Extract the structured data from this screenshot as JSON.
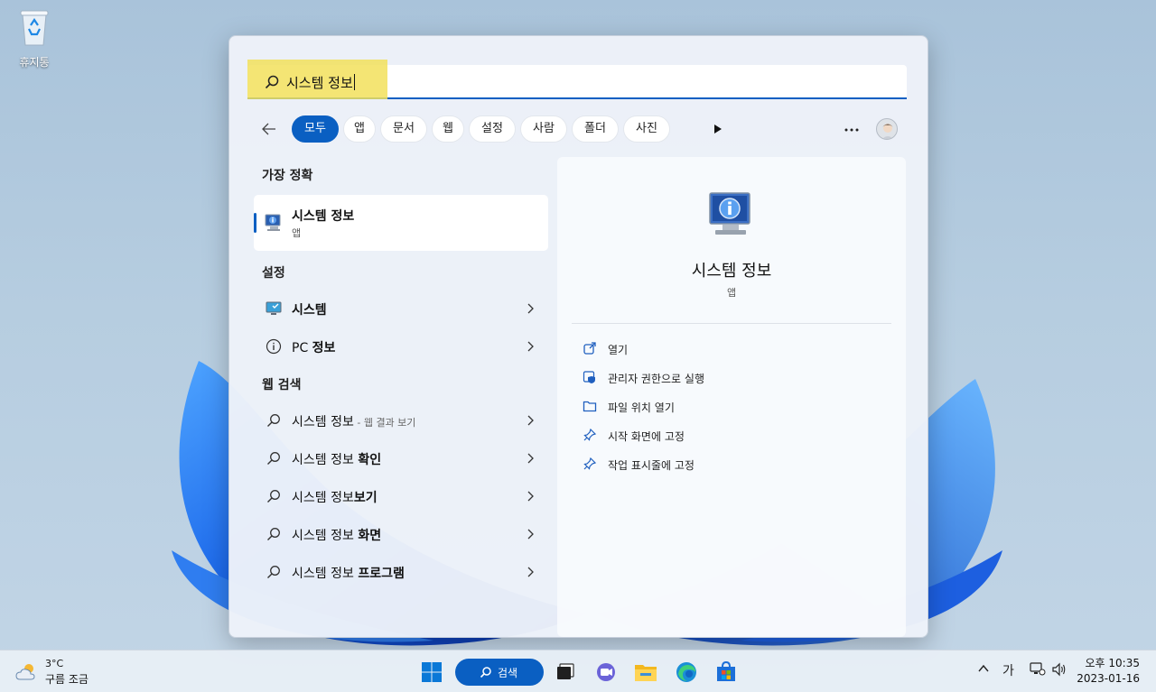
{
  "desktop": {
    "recycle_bin_label": "휴지통"
  },
  "search": {
    "query": "시스템 정보"
  },
  "filters": {
    "chips": [
      "모두",
      "앱",
      "문서",
      "웹",
      "설정",
      "사람",
      "폴더",
      "사진"
    ],
    "active": "모두"
  },
  "sections": {
    "best_match": "가장 정확",
    "settings": "설정",
    "web_search": "웹 검색"
  },
  "best_match": {
    "title": "시스템 정보",
    "type": "앱"
  },
  "settings_items": [
    {
      "label": "시스템",
      "icon": "monitor-settings-icon"
    },
    {
      "prefix": "PC ",
      "label": "정보",
      "icon": "info-icon"
    }
  ],
  "web_items": [
    {
      "plain": "시스템 정보",
      "bold": "",
      "suffix": " - 웹 결과 보기"
    },
    {
      "plain": "시스템 정보 ",
      "bold": "확인",
      "suffix": ""
    },
    {
      "plain": "시스템 정보",
      "bold": "보기",
      "suffix": ""
    },
    {
      "plain": "시스템 정보 ",
      "bold": "화면",
      "suffix": ""
    },
    {
      "plain": "시스템 정보 ",
      "bold": "프로그램",
      "suffix": ""
    }
  ],
  "preview": {
    "title": "시스템 정보",
    "type": "앱",
    "actions": [
      "열기",
      "관리자 권한으로 실행",
      "파일 위치 열기",
      "시작 화면에 고정",
      "작업 표시줄에 고정"
    ]
  },
  "taskbar": {
    "weather_temp": "3°C",
    "weather_desc": "구름 조금",
    "search_label": "검색",
    "ime": "가",
    "time": "오후 10:35",
    "date": "2023-01-16"
  },
  "colors": {
    "accent": "#0a5fc2",
    "highlight": "#f2e05c"
  }
}
